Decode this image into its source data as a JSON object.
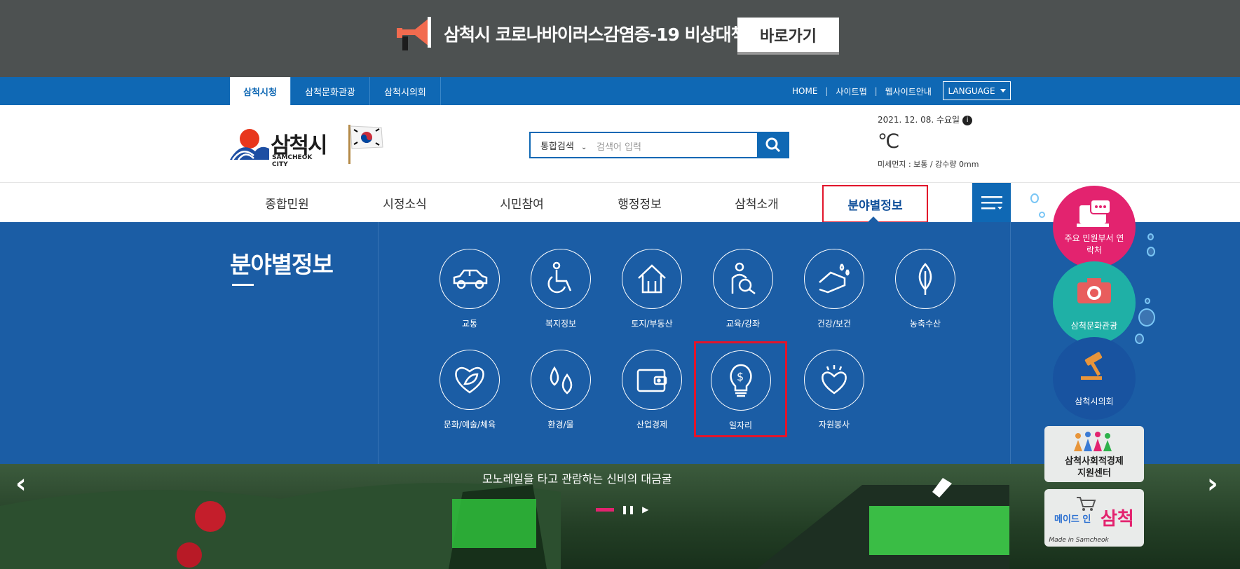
{
  "covid_banner": {
    "text": "삼척시 코로나바이러스감염증-19 비상대책",
    "button": "바로가기"
  },
  "util_bar": {
    "tabs": [
      "삼척시청",
      "삼척문화관광",
      "삼척시의회"
    ],
    "links": [
      "HOME",
      "사이트맵",
      "웹사이트안내"
    ],
    "language": "LANGUAGE"
  },
  "header": {
    "logo_name": "삼척시",
    "logo_eng": "SAMCHEOK CITY",
    "search_select": "통합검색",
    "search_placeholder": "검색어 입력",
    "weather_date": "2021. 12. 08. 수요일",
    "weather_temp": "℃",
    "weather_dust": "미세먼지 : 보통 / 강수량 0mm"
  },
  "gnb": [
    "종합민원",
    "시정소식",
    "시민참여",
    "행정정보",
    "삼척소개",
    "분야별정보"
  ],
  "panel": {
    "title": "분야별정보",
    "items": [
      {
        "label": "교통",
        "icon": "car-icon"
      },
      {
        "label": "복지정보",
        "icon": "wheelchair-icon"
      },
      {
        "label": "토지/부동산",
        "icon": "house-icon"
      },
      {
        "label": "교육/강좌",
        "icon": "education-icon"
      },
      {
        "label": "건강/보건",
        "icon": "health-icon"
      },
      {
        "label": "농축수산",
        "icon": "leaf-icon"
      },
      {
        "label": "문화/예술/체육",
        "icon": "heart-leaf-icon"
      },
      {
        "label": "환경/물",
        "icon": "water-drop-icon"
      },
      {
        "label": "산업경제",
        "icon": "wallet-icon"
      },
      {
        "label": "일자리",
        "icon": "lightbulb-dollar-icon"
      },
      {
        "label": "자원봉사",
        "icon": "heart-sparkle-icon"
      }
    ]
  },
  "slider": {
    "caption": "모노레일을 타고 관람하는 신비의 대금굴"
  },
  "quick_menu": {
    "items": [
      "주요 민원부서 연락처",
      "삼척문화관광",
      "삼척시의회"
    ],
    "card1": "삼척사회적경제 지원센터",
    "card2_script": "삼척",
    "card2_small": "Made in Samcheok",
    "card2_deco": "메이드 인"
  },
  "colors": {
    "primary_blue": "#0f68b4",
    "panel_blue": "#1b5da5",
    "highlight_red": "#e2152b",
    "quick_pink": "#e3236f",
    "quick_teal": "#1fb0a6",
    "quick_navy": "#1853a0"
  }
}
